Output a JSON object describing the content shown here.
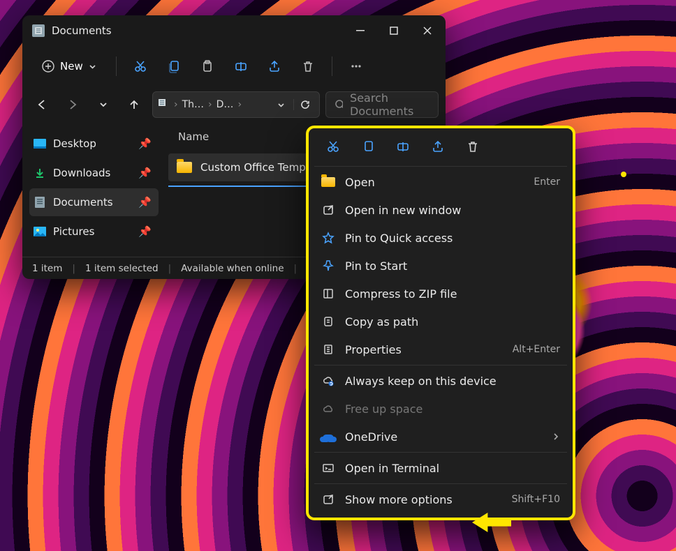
{
  "window": {
    "title": "Documents",
    "toolbar": {
      "new": "New"
    },
    "breadcrumb": {
      "seg1": "Th…",
      "seg2": "D…"
    },
    "search_placeholder": "Search Documents",
    "sidebar": [
      {
        "label": "Desktop"
      },
      {
        "label": "Downloads"
      },
      {
        "label": "Documents"
      },
      {
        "label": "Pictures"
      }
    ],
    "columns": {
      "name": "Name"
    },
    "files": [
      {
        "name": "Custom Office Templates"
      }
    ],
    "status": {
      "count": "1 item",
      "selected": "1 item selected",
      "availability": "Available when online"
    }
  },
  "context_menu": {
    "open": "Open",
    "open_hint": "Enter",
    "open_new_window": "Open in new window",
    "pin_quick": "Pin to Quick access",
    "pin_start": "Pin to Start",
    "zip": "Compress to ZIP file",
    "copy_path": "Copy as path",
    "properties": "Properties",
    "properties_hint": "Alt+Enter",
    "keep_device": "Always keep on this device",
    "free_space": "Free up space",
    "onedrive": "OneDrive",
    "terminal": "Open in Terminal",
    "more": "Show more options",
    "more_hint": "Shift+F10"
  }
}
